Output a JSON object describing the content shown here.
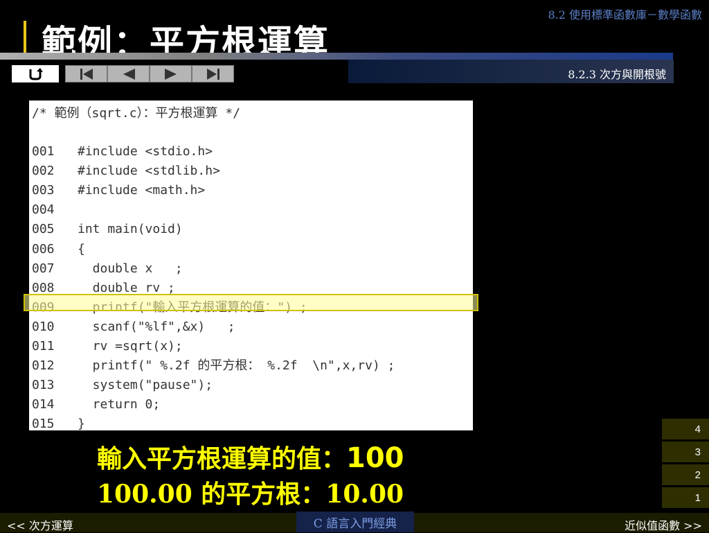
{
  "header": {
    "chapter": "8.2  使用標準函數庫－數學函數",
    "title": "範例：平方根運算",
    "section": "8.2.3 次方與開根號"
  },
  "nav": {
    "buttons": [
      {
        "name": "return-button",
        "icon": "return-icon"
      },
      {
        "name": "first-button",
        "icon": "first-icon"
      },
      {
        "name": "prev-button",
        "icon": "prev-icon"
      },
      {
        "name": "next-button",
        "icon": "next-icon"
      },
      {
        "name": "last-button",
        "icon": "last-icon"
      }
    ]
  },
  "code": {
    "comment": "/* 範例（sqrt.c）：平方根運算 */",
    "lines": [
      {
        "num": "001",
        "text": "#include <stdio.h>"
      },
      {
        "num": "002",
        "text": "#include <stdlib.h>"
      },
      {
        "num": "003",
        "text": "#include <math.h>"
      },
      {
        "num": "004",
        "text": ""
      },
      {
        "num": "005",
        "text": "int main(void)"
      },
      {
        "num": "006",
        "text": "{"
      },
      {
        "num": "007",
        "text": "  double x   ;"
      },
      {
        "num": "008",
        "text": "  double rv ;"
      },
      {
        "num": "009",
        "text": "  printf(\"輸入平方根運算的值：\") ;"
      },
      {
        "num": "010",
        "text": "  scanf(\"%lf\",&x)   ;"
      },
      {
        "num": "011",
        "text": "  rv =sqrt(x);"
      },
      {
        "num": "012",
        "text": "  printf(\" %.2f 的平方根： %.2f  \\n\",x,rv) ;"
      },
      {
        "num": "013",
        "text": "  system(\"pause\");"
      },
      {
        "num": "014",
        "text": "  return 0;"
      },
      {
        "num": "015",
        "text": "}"
      }
    ],
    "highlight_line": "009",
    "highlight_color": "#ffff99"
  },
  "output": {
    "line1_prompt": "輸入平方根運算的值：",
    "line1_input": "100",
    "line2": "100.00 的平方根：10.00",
    "color": "#ffff00"
  },
  "pages": [
    "4",
    "3",
    "2",
    "1"
  ],
  "footer": {
    "prev": "<< 次方運算",
    "book": "C 語言入門經典",
    "next": "近似值函數 >>"
  }
}
